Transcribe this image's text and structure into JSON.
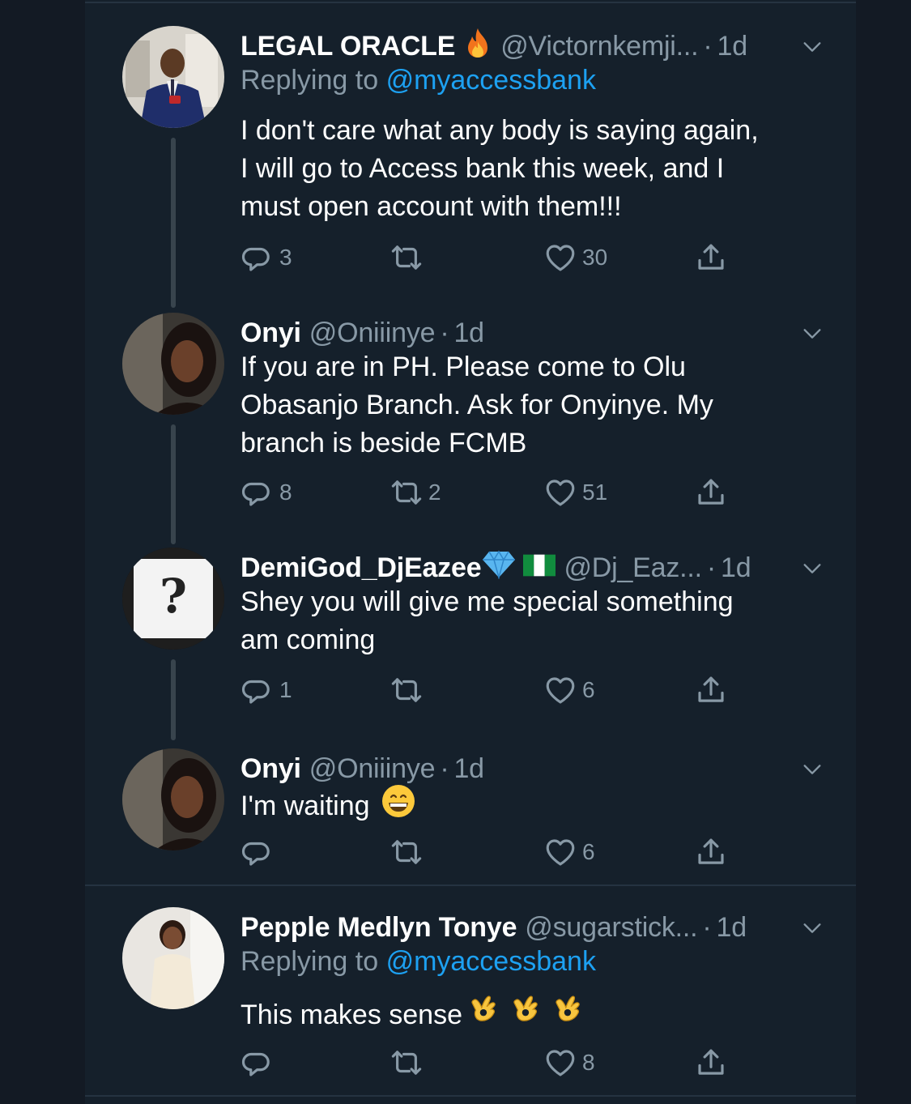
{
  "tweets": [
    {
      "name": "LEGAL ORACLE",
      "handle": "@Victornkemji...",
      "time": "1d",
      "replying_prefix": "Replying to",
      "replying_to": "@myaccessbank",
      "lines": [
        "I don't care what any body is saying again,",
        "I will go to Access bank this week, and I",
        "must open account with them!!!"
      ],
      "replies": "3",
      "retweets": "",
      "likes": "30",
      "badges": [
        "fire-emoji"
      ]
    },
    {
      "name": "Onyi",
      "handle": "@Oniiinye",
      "time": "1d",
      "lines": [
        "If you are in PH. Please come to Olu",
        "Obasanjo Branch. Ask for Onyinye. My",
        "branch is beside FCMB"
      ],
      "replies": "8",
      "retweets": "2",
      "likes": "51"
    },
    {
      "name": "DemiGod_DjEazee",
      "handle": "@Dj_Eaz...",
      "time": "1d",
      "lines": [
        "Shey you will give me special something",
        "am coming"
      ],
      "replies": "1",
      "retweets": "",
      "likes": "6",
      "badges": [
        "diamond-emoji",
        "nigeria-flag-emoji"
      ]
    },
    {
      "name": "Onyi",
      "handle": "@Oniiinye",
      "time": "1d",
      "lines": [
        "I'm waiting"
      ],
      "replies": "",
      "retweets": "",
      "likes": "6",
      "badges": [
        "grinning-face-emoji"
      ]
    },
    {
      "name": "Pepple Medlyn Tonye",
      "handle": "@sugarstick...",
      "time": "1d",
      "replying_prefix": "Replying to",
      "replying_to": "@myaccessbank",
      "lines": [
        "This makes sense"
      ],
      "replies": "",
      "retweets": "",
      "likes": "8",
      "badges": [
        "ok-hand-emoji",
        "ok-hand-emoji",
        "ok-hand-emoji"
      ]
    }
  ],
  "colors": {
    "background": "#15202b",
    "text": "#ffffff",
    "secondary": "#8899a6",
    "link": "#1da1f2",
    "divider": "#253341"
  },
  "icons": [
    "reply-icon",
    "retweet-icon",
    "like-icon",
    "share-icon",
    "chevron-down-icon"
  ]
}
